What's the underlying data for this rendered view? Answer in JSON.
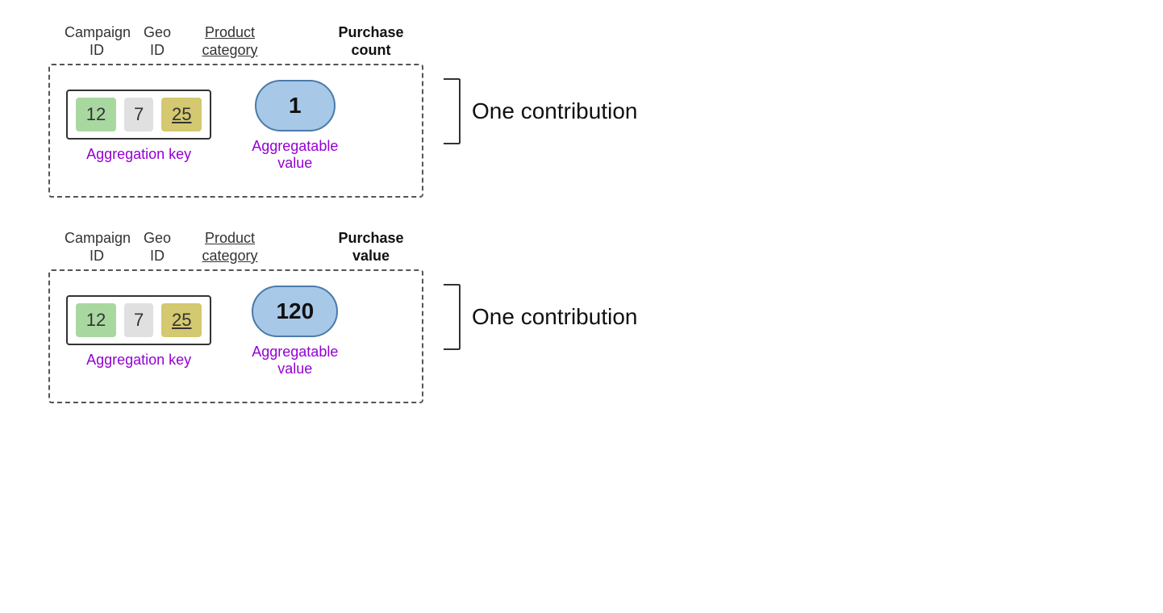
{
  "diagram": {
    "sections": [
      {
        "id": "section-1",
        "headers": {
          "campaign": "Campaign\nID",
          "geo": "Geo\nID",
          "product": "Product\ncategory",
          "purchase": "Purchase\ncount"
        },
        "key": {
          "campaign_value": "12",
          "geo_value": "7",
          "product_value": "25",
          "agg_key_label": "Aggregation key"
        },
        "value": {
          "bubble_value": "1",
          "agg_value_label": "Aggregatable\nvalue"
        },
        "contribution_label": "One contribution"
      },
      {
        "id": "section-2",
        "headers": {
          "campaign": "Campaign\nID",
          "geo": "Geo\nID",
          "product": "Product\ncategory",
          "purchase": "Purchase\nvalue"
        },
        "key": {
          "campaign_value": "12",
          "geo_value": "7",
          "product_value": "25",
          "agg_key_label": "Aggregation key"
        },
        "value": {
          "bubble_value": "120",
          "agg_value_label": "Aggregatable\nvalue"
        },
        "contribution_label": "One contribution"
      }
    ]
  }
}
